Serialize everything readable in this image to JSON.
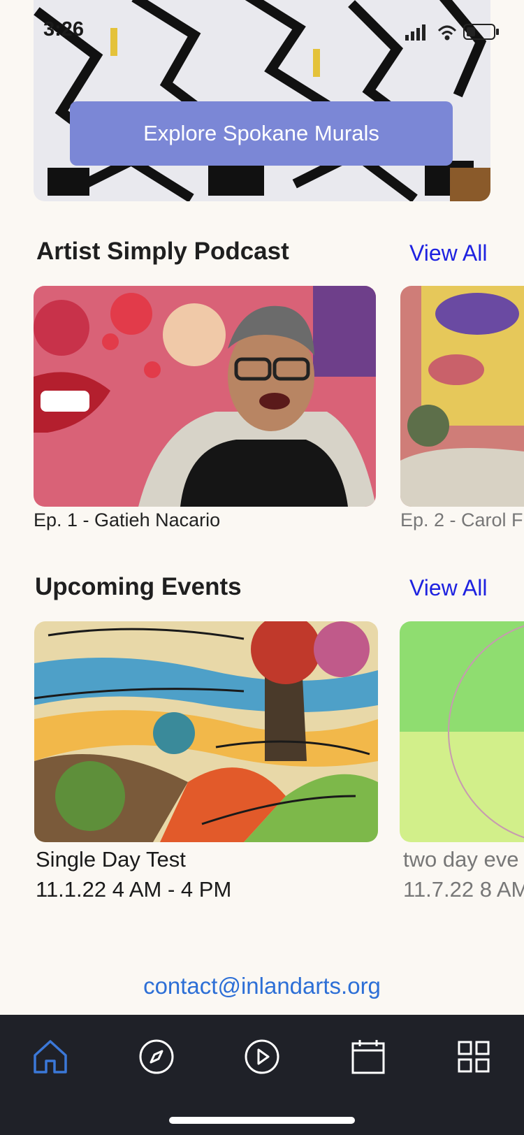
{
  "status_bar": {
    "time": "3:26"
  },
  "hero": {
    "button_label": "Explore Spokane Murals"
  },
  "podcast": {
    "title": "Artist Simply Podcast",
    "view_all": "View All",
    "episodes": [
      {
        "label": "Ep. 1 - Gatieh Nacario"
      },
      {
        "label": "Ep. 2 - Carol F"
      }
    ]
  },
  "events": {
    "title": "Upcoming Events",
    "view_all": "View All",
    "items": [
      {
        "title": "Single Day Test",
        "date": "11.1.22 4 AM - 4 PM"
      },
      {
        "title": "two day eve",
        "date": "11.7.22 8 AM"
      }
    ]
  },
  "footer": {
    "contact": "contact@inlandarts.org"
  },
  "tab_bar": {
    "tabs": [
      {
        "icon": "home-icon",
        "active": true
      },
      {
        "icon": "compass-icon",
        "active": false
      },
      {
        "icon": "play-icon",
        "active": false
      },
      {
        "icon": "calendar-icon",
        "active": false
      },
      {
        "icon": "grid-icon",
        "active": false
      }
    ],
    "active_color": "#3b78d8",
    "inactive_color": "#ffffff"
  },
  "colors": {
    "accent": "#1e22e0",
    "hero_button": "#7b87d6",
    "background": "#fbf8f3"
  }
}
